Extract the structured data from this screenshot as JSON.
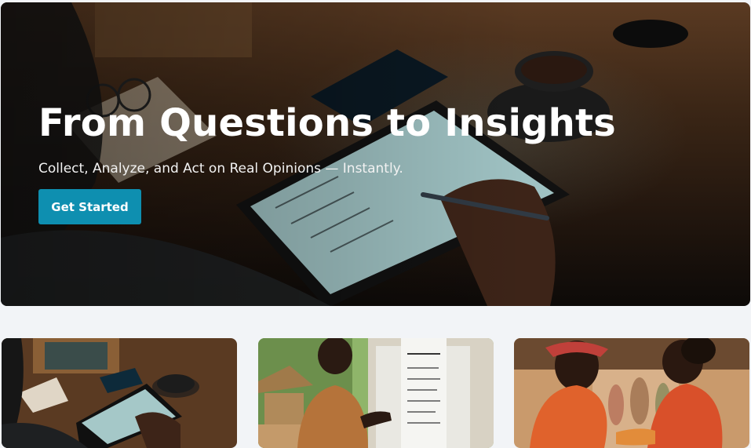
{
  "hero": {
    "title": "From Questions to Insights",
    "subtitle": "Collect, Analyze, and Act on Real Opinions — Instantly.",
    "cta_label": "Get Started"
  },
  "cards": [
    {
      "image": "person-filling-survey-on-tablet-photo"
    },
    {
      "image": "man-writing-on-survey-board-photo"
    },
    {
      "image": "women-talking-at-market-photo"
    }
  ],
  "colors": {
    "accent": "#0e8fb0",
    "page_background": "#f2f4f7",
    "hero_text": "#ffffff"
  }
}
